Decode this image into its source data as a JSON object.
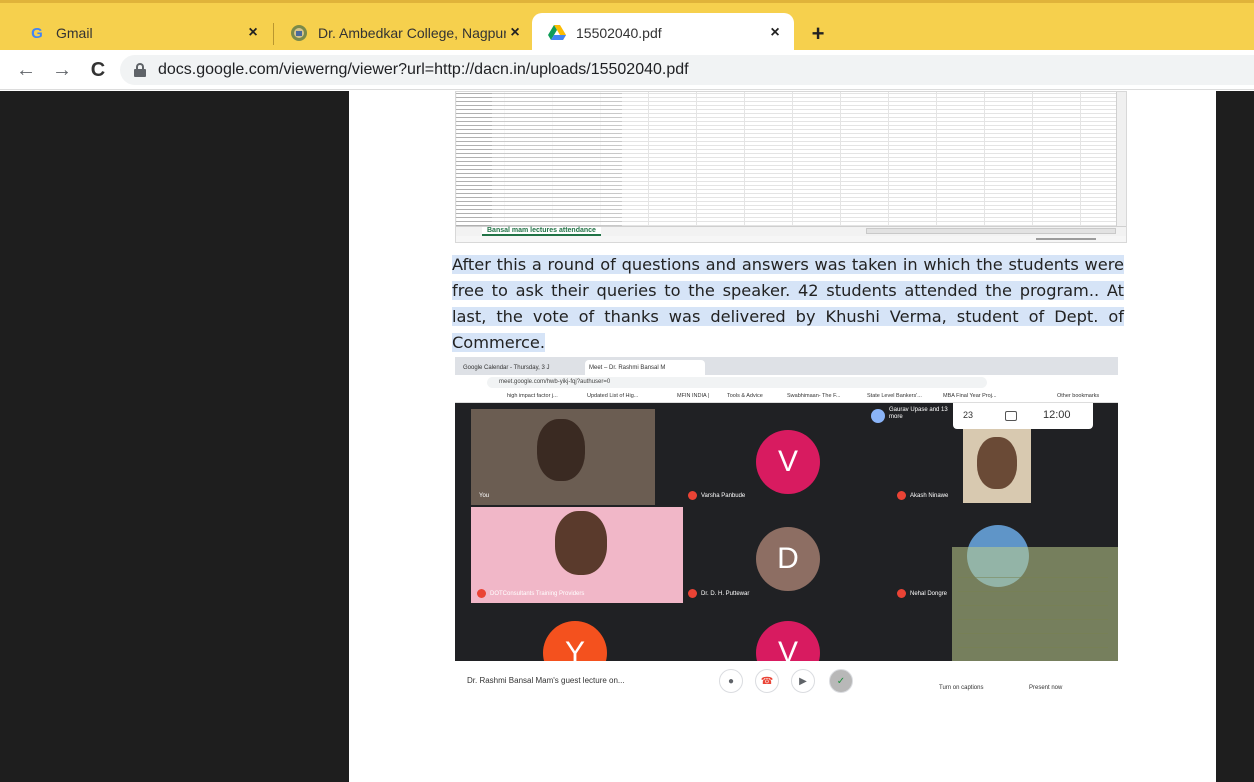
{
  "browser": {
    "tabs": [
      {
        "title": "Gmail",
        "icon": "gmail-icon"
      },
      {
        "title": "Dr. Ambedkar College, Nagpur",
        "icon": "college-logo-icon"
      },
      {
        "title": "15502040.pdf",
        "icon": "google-drive-icon"
      }
    ],
    "close_symbol": "×",
    "new_tab_symbol": "+",
    "active_tab_index": 2,
    "url": "docs.google.com/viewerng/viewer?url=http://dacn.in/uploads/15502040.pdf",
    "nav": {
      "back": "←",
      "forward": "→",
      "reload": "C"
    }
  },
  "document": {
    "spreadsheet": {
      "sheet_tab": "Bansal mam lectures attendance"
    },
    "paragraph": "After this a round of questions and answers was taken in  which the students were free to ask their  queries to the speaker. 42 students attended the program.. At last, the vote of thanks was delivered by  Khushi Verma, student of Dept. of Commerce.",
    "meet_screenshot": {
      "tabs": [
        "Google Calendar - Thursday, 3 J",
        "Meet – Dr. Rashmi Bansal M"
      ],
      "url": "meet.google.com/hwb-yikj-fqj?authuser=0",
      "bookmarks": [
        "high impact factor j...",
        "Updated List of Hig...",
        "MFIN INDIA |",
        "Tools & Advice",
        "Swabhimaan- The F...",
        "State Level Bankers'...",
        "MBA Final Year Proj...",
        "Other bookmarks"
      ],
      "header_participant": "Gaurav Upase and 13 more",
      "participant_count": "23",
      "time": "12:00",
      "participants": [
        {
          "name": "You",
          "type": "video"
        },
        {
          "name": "Varsha Panbude",
          "initial": "V",
          "color": "#d81b60"
        },
        {
          "name": "Akash Ninawe",
          "type": "video"
        },
        {
          "name": "DOTConsultants Training Providers",
          "type": "video"
        },
        {
          "name": "Dr. D. H. Puttewar",
          "initial": "D",
          "color": "#8d6e63"
        },
        {
          "name": "Nehal Dongre",
          "type": "video"
        },
        {
          "name": "",
          "initial": "Y",
          "color": "#f4511e"
        },
        {
          "name": "",
          "initial": "V",
          "color": "#d81b60"
        }
      ],
      "meeting_title": "Dr. Rashmi Bansal Mam's guest lecture on...",
      "captions_label": "Turn on captions",
      "present_label": "Present now"
    }
  }
}
